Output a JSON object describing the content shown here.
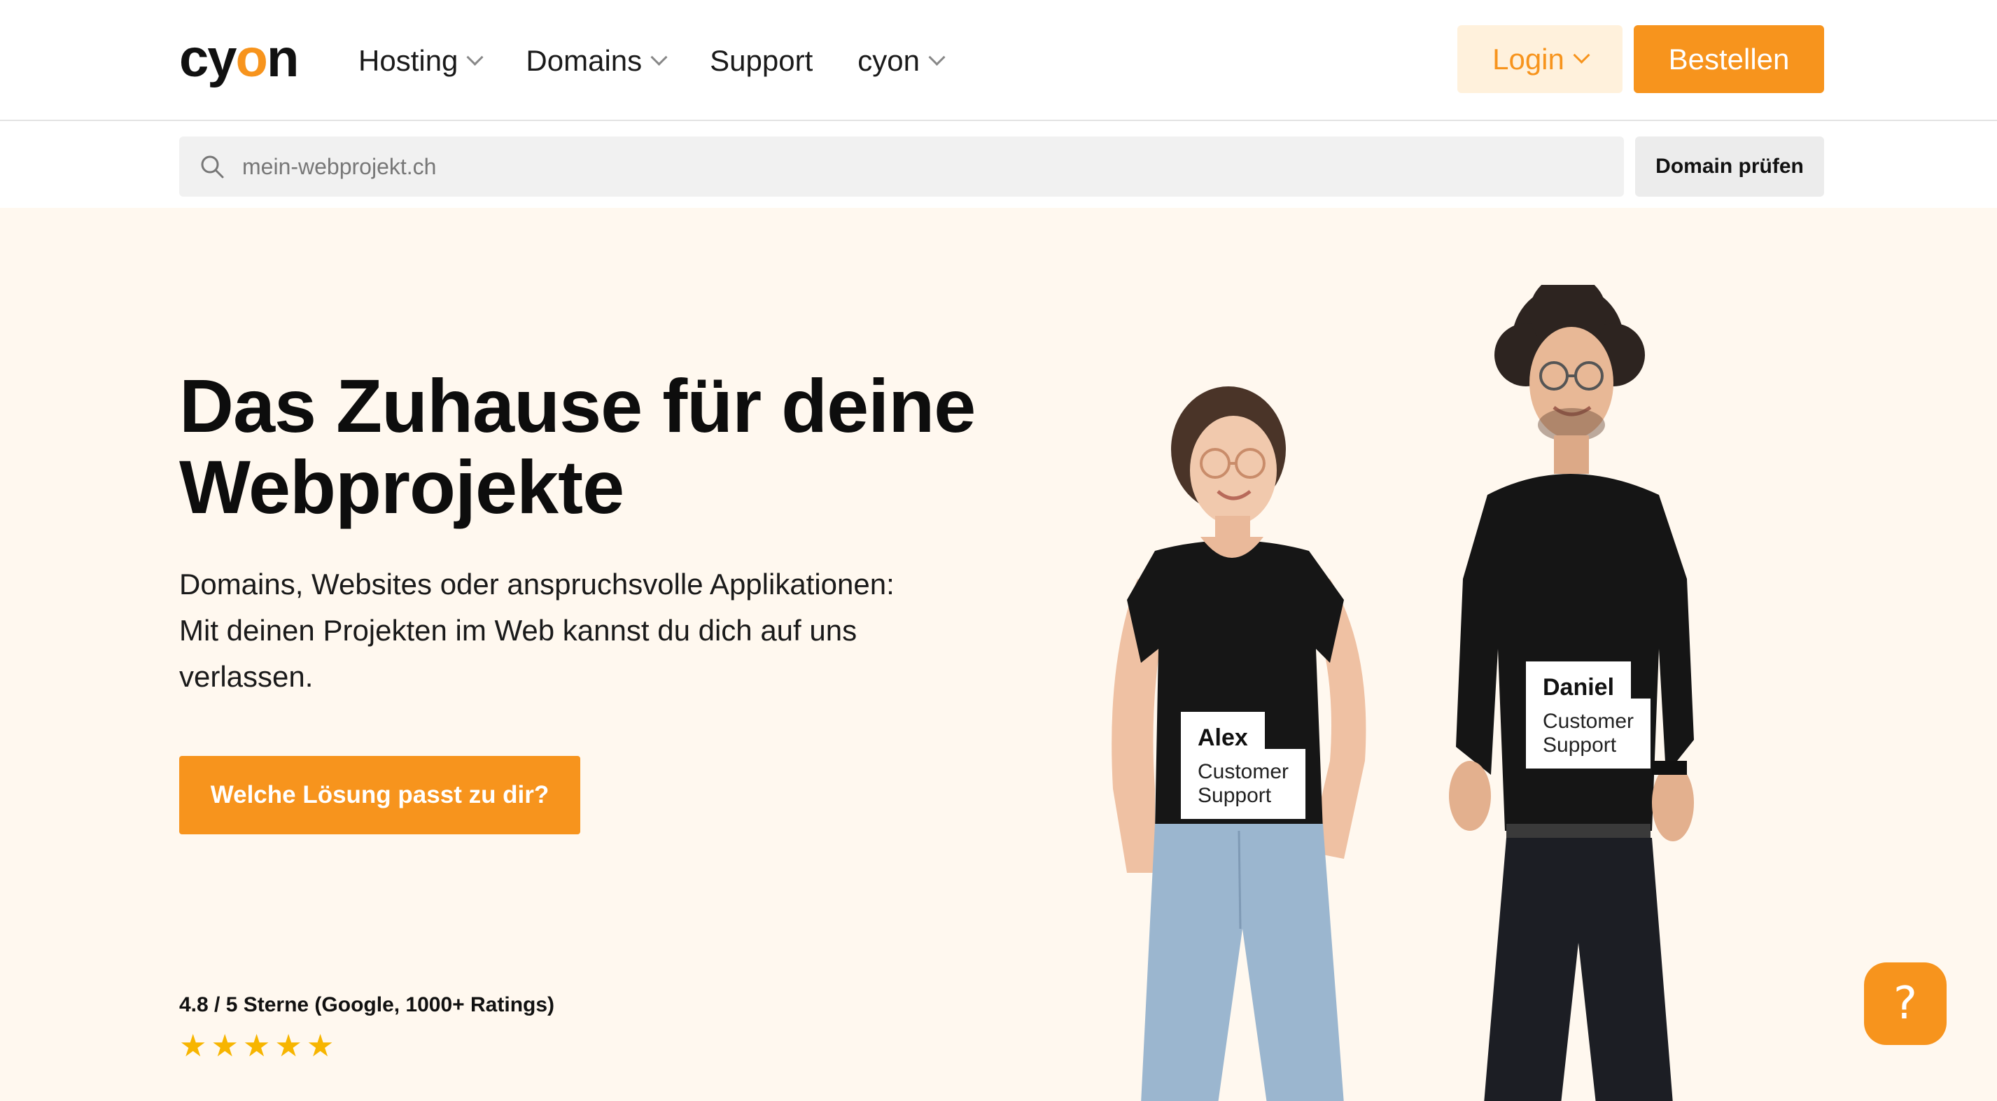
{
  "header": {
    "logo_text_a": "cy",
    "logo_text_o": "o",
    "logo_text_b": "n",
    "nav": [
      {
        "label": "Hosting",
        "has_dropdown": true
      },
      {
        "label": "Domains",
        "has_dropdown": true
      },
      {
        "label": "Support",
        "has_dropdown": false
      },
      {
        "label": "cyon",
        "has_dropdown": true
      }
    ],
    "login_label": "Login",
    "order_label": "Bestellen"
  },
  "search": {
    "placeholder": "mein-webprojekt.ch",
    "button_label": "Domain prüfen"
  },
  "hero": {
    "title": "Das Zuhause für deine Webprojekte",
    "subtitle": "Domains, Websites oder anspruchsvolle Applikationen: Mit deinen Projekten im Web kannst du dich auf uns verlassen.",
    "cta_label": "Welche Lösung passt zu dir?",
    "rating_text": "4.8 / 5 Sterne (Google, 1000+ Ratings)",
    "stars": 5
  },
  "people": [
    {
      "name": "Alex",
      "role": "Customer Support"
    },
    {
      "name": "Daniel",
      "role": "Customer Support"
    }
  ],
  "help_label": "?",
  "colors": {
    "accent": "#f7941d",
    "login_bg": "#fff1dc",
    "hero_bg": "#fff8ef",
    "star": "#f7b500"
  }
}
